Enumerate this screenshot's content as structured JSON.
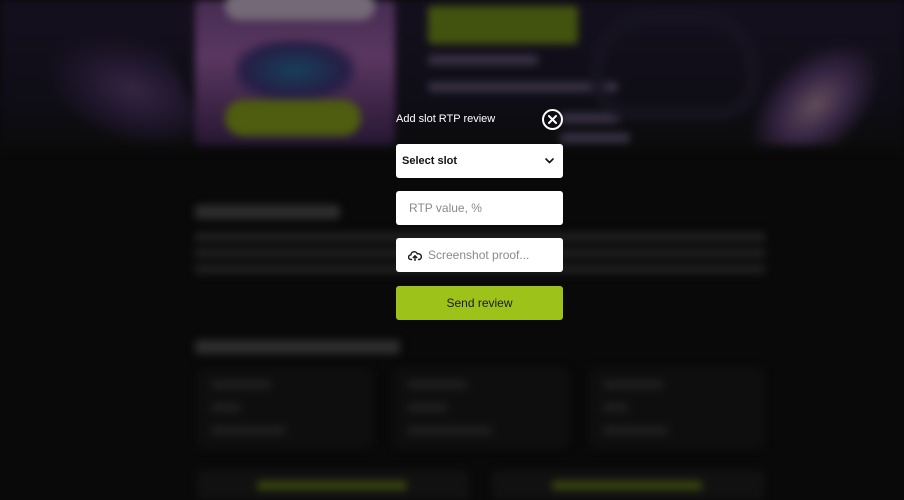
{
  "modal": {
    "title": "Add slot RTP review",
    "slot_select": {
      "value": "Select slot",
      "icon": "chevron-down-icon"
    },
    "rtp_input": {
      "placeholder": "RTP value, %",
      "value": ""
    },
    "screenshot_upload": {
      "placeholder": "Screenshot proof...",
      "icon": "cloud-upload-icon"
    },
    "send_button_label": "Send review",
    "close_icon": "close-icon"
  },
  "colors": {
    "accent": "#9dc31a",
    "overlay": "rgba(0,0,0,0.5)",
    "page_background": "#121212"
  }
}
